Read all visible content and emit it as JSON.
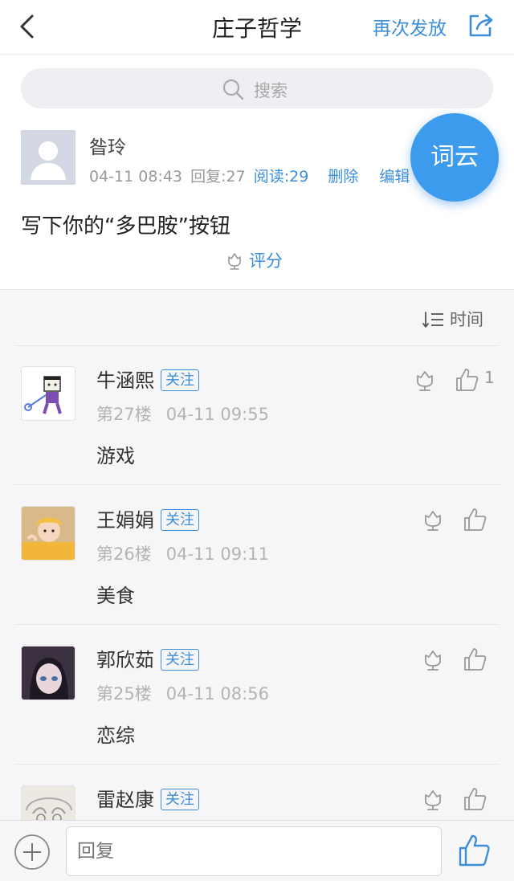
{
  "header": {
    "title": "庄子哲学",
    "resend_label": "再次发放"
  },
  "search": {
    "placeholder": "搜索"
  },
  "post": {
    "author": "昝玲",
    "time": "04-11 08:43",
    "replies": "回复:27",
    "reads": "阅读:29",
    "delete_label": "删除",
    "edit_label": "编辑",
    "content": "写下你的“多巴胺”按钮",
    "rate_label": "评分"
  },
  "floating_button": {
    "label": "词云"
  },
  "sort": {
    "label": "时间"
  },
  "comments": [
    {
      "name": "牛涵熙",
      "follow": "关注",
      "floor": "第27楼",
      "time": "04-11 09:55",
      "text": "游戏",
      "likes": "1"
    },
    {
      "name": "王娟娟",
      "follow": "关注",
      "floor": "第26楼",
      "time": "04-11 09:11",
      "text": "美食",
      "likes": ""
    },
    {
      "name": "郭欣茹",
      "follow": "关注",
      "floor": "第25楼",
      "time": "04-11 08:56",
      "text": "恋综",
      "likes": ""
    },
    {
      "name": "雷赵康",
      "follow": "关注",
      "floor": "",
      "time": "",
      "text": "",
      "likes": ""
    }
  ],
  "reply_bar": {
    "placeholder": "回复"
  },
  "colors": {
    "accent": "#3d8ed8",
    "fab": "#3c9bec"
  }
}
